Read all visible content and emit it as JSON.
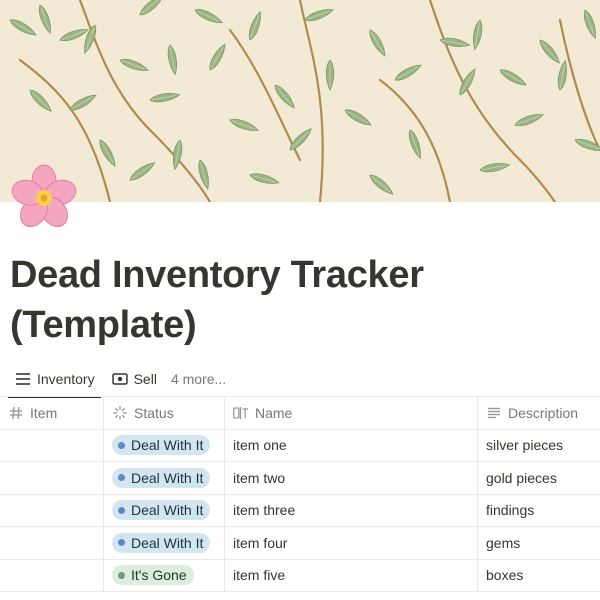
{
  "page": {
    "title": "Dead Inventory Tracker (Template)",
    "icon": "cherry-blossom-icon"
  },
  "tabs": [
    {
      "label": "Inventory",
      "icon": "list-icon",
      "active": true
    },
    {
      "label": "Sell",
      "icon": "money-icon",
      "active": false
    },
    {
      "label": "4 more...",
      "active": false
    }
  ],
  "table": {
    "columns": [
      {
        "label": "Item",
        "icon": "hash-icon"
      },
      {
        "label": "Status",
        "icon": "status-icon"
      },
      {
        "label": "Name",
        "icon": "title-icon"
      },
      {
        "label": "Description",
        "icon": "text-lines-icon"
      }
    ],
    "rows": [
      {
        "item": "",
        "status": "Deal With It",
        "name": "item one",
        "description": "silver pieces"
      },
      {
        "item": "",
        "status": "Deal With It",
        "name": "item two",
        "description": "gold pieces"
      },
      {
        "item": "",
        "status": "Deal With It",
        "name": "item three",
        "description": "findings"
      },
      {
        "item": "",
        "status": "Deal With It",
        "name": "item four",
        "description": "gems"
      },
      {
        "item": "",
        "status": "It's Gone",
        "name": "item five",
        "description": "boxes"
      }
    ]
  },
  "colors": {
    "status_deal_bg": "#d3e5ef",
    "status_deal_dot": "#5e87c9",
    "status_gone_bg": "#dbeddb",
    "status_gone_dot": "#6c9b7d",
    "cover_bg": "#f3ead6",
    "leaf_green": "#9bb382"
  }
}
